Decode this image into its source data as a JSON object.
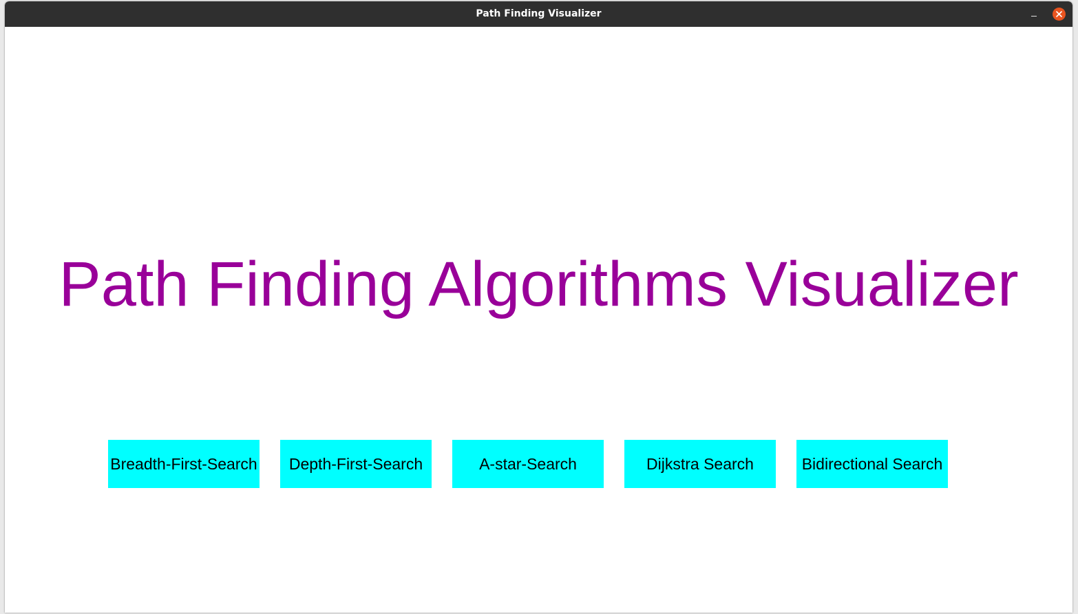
{
  "window": {
    "title": "Path Finding Visualizer",
    "minimize_glyph": "–"
  },
  "main": {
    "title": "Path Finding Algorithms Visualizer",
    "title_color": "#990099",
    "button_color": "#00ffff",
    "buttons": [
      {
        "label": "Breadth-First-Search"
      },
      {
        "label": "Depth-First-Search"
      },
      {
        "label": "A-star-Search"
      },
      {
        "label": "Dijkstra Search"
      },
      {
        "label": "Bidirectional Search"
      }
    ]
  },
  "icons": {
    "close": "close-icon",
    "minimize": "minimize-icon"
  }
}
